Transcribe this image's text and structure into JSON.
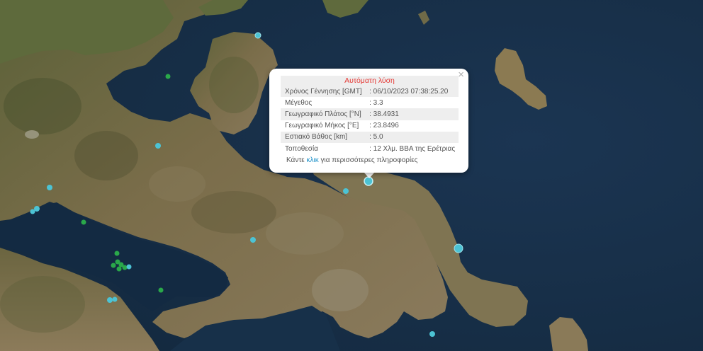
{
  "popup": {
    "title": "Αυτόματη λύση",
    "close_symbol": "×",
    "rows": [
      {
        "label": "Χρόνος Γέννησης [GMT]",
        "value": ": 06/10/2023 07:38:25.20"
      },
      {
        "label": "Μέγεθος",
        "value": ": 3.3"
      },
      {
        "label": "Γεωγραφικό Πλάτος [°N]",
        "value": ": 38.4931"
      },
      {
        "label": "Γεωγραφικό Μήκος [°E]",
        "value": ": 23.8496"
      },
      {
        "label": "Εστιακό Βάθος [km]",
        "value": ": 5.0"
      },
      {
        "label": "Τοποθεσία",
        "value": ": 12 Χλμ. ΒΒΑ της Ερέτριας"
      }
    ],
    "more_prefix": "Κάντε ",
    "more_link": "κλικ",
    "more_suffix": " για περισσότερες πληροφορίες"
  },
  "colors": {
    "sea": "#183049",
    "land": "#6d6a47",
    "quake_recent": "#4cc3d4",
    "quake_older": "#2aa84a",
    "title_red": "#e53935"
  },
  "markers": {
    "selected_magnitude": 3.3
  }
}
